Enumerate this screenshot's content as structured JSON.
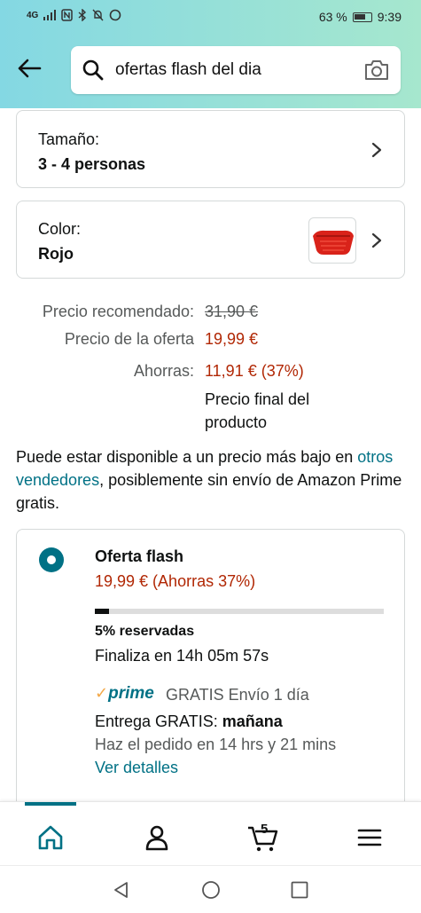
{
  "status_bar": {
    "network": "4G",
    "battery_percent": "63 %",
    "time": "9:39"
  },
  "search": {
    "query": "ofertas flash del dia"
  },
  "size_selector": {
    "label": "Tamaño:",
    "value": "3 - 4 personas"
  },
  "color_selector": {
    "label": "Color:",
    "value": "Rojo"
  },
  "pricing": {
    "recommended_label": "Precio recomendado:",
    "recommended_value": "31,90 €",
    "offer_label": "Precio de la oferta",
    "offer_value": "19,99 €",
    "savings_label": "Ahorras:",
    "savings_value": "11,91 € (37%)",
    "final_note_line1": "Precio final del",
    "final_note_line2": "producto"
  },
  "availability": {
    "text_before": "Puede estar disponible a un precio más bajo en ",
    "link": "otros vendedores",
    "text_after": ", posiblemente sin envío de Amazon Prime gratis."
  },
  "flash_offer": {
    "title": "Oferta flash",
    "price": "19,99 € (Ahorras 37%)",
    "claimed_fraction": 0.05,
    "reserved": "5% reservadas",
    "ends": "Finaliza en 14h 05m 57s",
    "prime_check": "✓",
    "prime_label": "prime",
    "shipping": "GRATIS Envío 1 día",
    "delivery_prefix": "Entrega GRATIS: ",
    "delivery_day": "mañana",
    "order_within": "Haz el pedido en 14 hrs y 21 mins",
    "details_link": "Ver detalles"
  },
  "bottom_nav": {
    "cart_count": "5",
    "active_color": "#007185"
  },
  "colors": {
    "accent": "#007185",
    "price_red": "#b12704",
    "header_from": "#84d8e3",
    "header_to": "#a6e7ce"
  }
}
